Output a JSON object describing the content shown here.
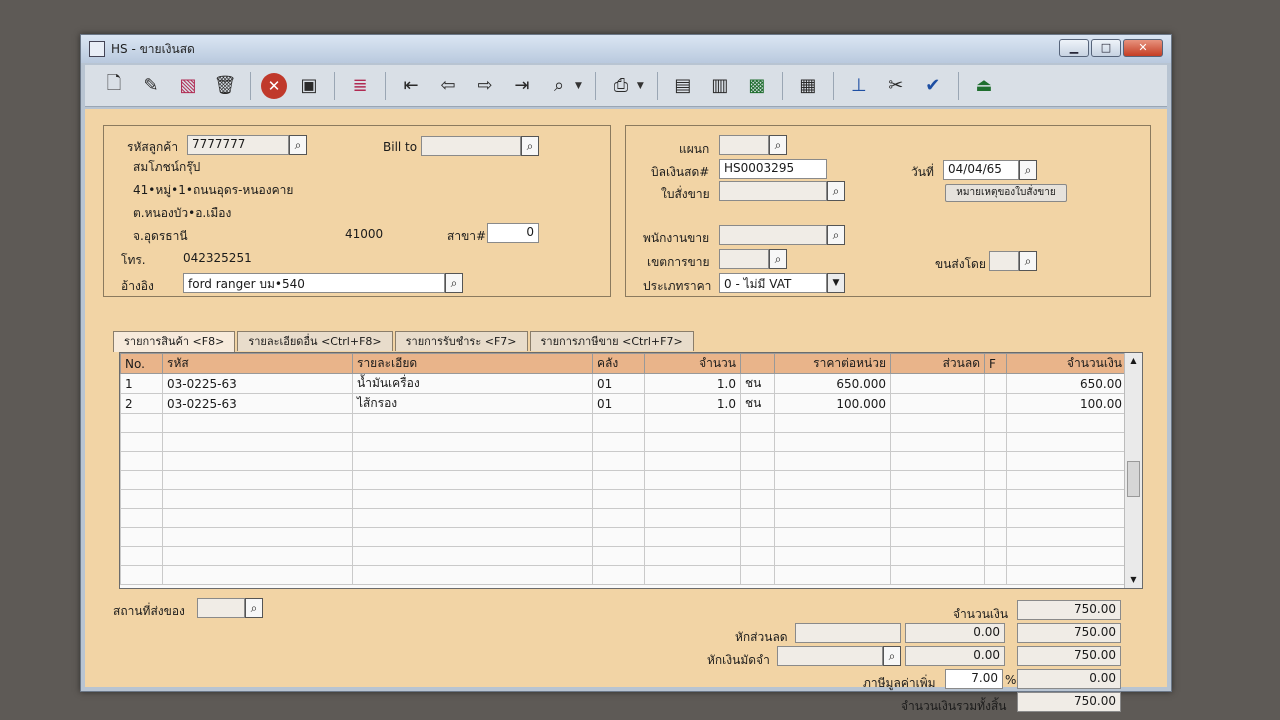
{
  "window": {
    "title": "HS - ขายเงินสด",
    "min": "▁",
    "max": "□",
    "close": "✕"
  },
  "toolbar": {
    "icons": [
      "new-icon",
      "edit-icon",
      "delete-doc-icon",
      "trash-icon",
      "cancel-icon",
      "save-icon",
      "books-icon",
      "first-record-icon",
      "prev-record-icon",
      "next-record-icon",
      "last-record-icon",
      "find-icon",
      "print-icon",
      "window1-icon",
      "window2-icon",
      "image-icon",
      "calculator-icon",
      "dc-icon",
      "tools-icon",
      "ok-icon",
      "exit-icon"
    ]
  },
  "customer": {
    "code_label": "รหัสลูกค้า",
    "code": "7777777",
    "name": "สมโภชน์กรุ๊ป",
    "address1": "41•หมู่•1•ถนนอุดร-หนองคาย",
    "address2": "ต.หนองบัว•อ.เมือง",
    "province": "จ.อุดรธานี",
    "postcode": "41000",
    "branch_label": "สาขา#",
    "branch": "0",
    "phone_label": "โทร.",
    "phone": "042325251",
    "ref_label": "อ้างอิง",
    "ref": "ford ranger บม•540",
    "billto_label": "Bill to",
    "billto": ""
  },
  "doc": {
    "dept_label": "แผนก",
    "dept": "",
    "bill_label": "บิลเงินสด#",
    "bill": "HS0003295",
    "so_label": "ใบสั่งขาย",
    "so": "",
    "date_label": "วันที่",
    "date": "04/04/65",
    "note_button": "หมายเหตุของใบสั่งขาย",
    "salesman_label": "พนักงานขาย",
    "salesman": "",
    "area_label": "เขตการขาย",
    "area": "",
    "pricetype_label": "ประเภทราคา",
    "pricetype": "0 - ไม่มี VAT",
    "ship_label": "ขนส่งโดย",
    "ship": ""
  },
  "tabs": [
    "รายการสินค้า <F8>",
    "รายละเอียดอื่น <Ctrl+F8>",
    "รายการรับชำระ <F7>",
    "รายการภาษีขาย <Ctrl+F7>"
  ],
  "grid": {
    "headers": [
      "No.",
      "รหัส",
      "รายละเอียด",
      "คลัง",
      "จำนวน",
      "",
      "ราคาต่อหน่วย",
      "ส่วนลด",
      "F",
      "จำนวนเงิน"
    ],
    "rows": [
      [
        "1",
        "03-0225-63",
        "น้ำมันเครื่อง",
        "01",
        "1.0",
        "ชน",
        "650.000",
        "",
        "",
        "650.00"
      ],
      [
        "2",
        "03-0225-63",
        "ไส้กรอง",
        "01",
        "1.0",
        "ชน",
        "100.000",
        "",
        "",
        "100.00"
      ]
    ],
    "empty_rows": 9
  },
  "footer": {
    "ship_place_label": "สถานที่ส่งของ",
    "ship_place": "",
    "amount_label": "จำนวนเงิน",
    "amount": "750.00",
    "discount_label": "หักส่วนลด",
    "discount_text": "",
    "discount": "0.00",
    "after_discount": "750.00",
    "deposit_label": "หักเงินมัดจำ",
    "deposit_ref": "",
    "deposit": "0.00",
    "after_deposit": "750.00",
    "vat_label": "ภาษีมูลค่าเพิ่ม",
    "vat_rate": "7.00",
    "vat_pct": "%",
    "vat": "0.00",
    "total_label": "จำนวนเงินรวมทั้งสิ้น",
    "total": "750.00"
  }
}
